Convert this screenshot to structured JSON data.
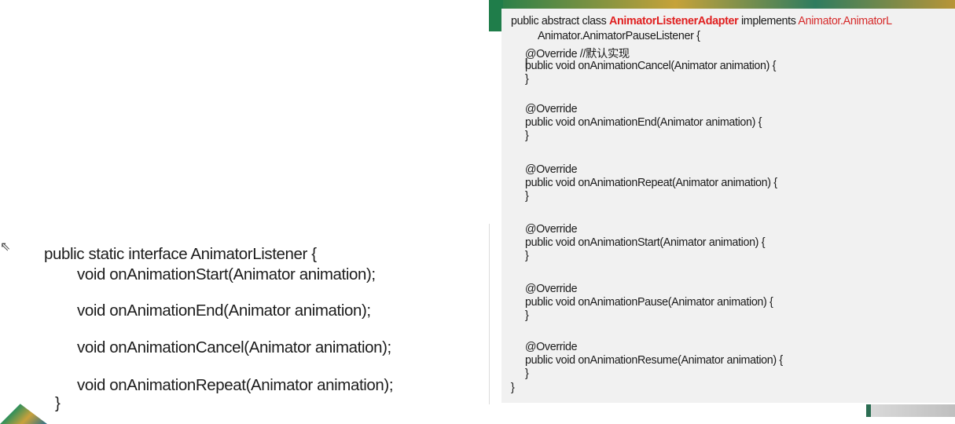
{
  "left_slide": {
    "lines": [
      "public static interface AnimatorListener {",
      "void onAnimationStart(Animator animation);",
      "void onAnimationEnd(Animator animation);",
      "void onAnimationCancel(Animator animation);",
      "void onAnimationRepeat(Animator animation);",
      "}"
    ]
  },
  "right_panel": {
    "header": {
      "prefix": "public abstract class ",
      "class_name": "AnimatorListenerAdapter",
      "implements": " implements ",
      "interface": "Animator.AnimatorL",
      "line2": "Animator.AnimatorPauseListener {"
    },
    "annotation_comment": "@Override //默认实现",
    "methods": [
      {
        "annotation": "",
        "signature": "public void onAnimationCancel(Animator animation) {",
        "close": "}"
      },
      {
        "annotation": "@Override",
        "signature": "public void onAnimationEnd(Animator animation) {",
        "close": "}"
      },
      {
        "annotation": "@Override",
        "signature": "public void onAnimationRepeat(Animator animation) {",
        "close": "}"
      },
      {
        "annotation": "@Override",
        "signature": "public void onAnimationStart(Animator animation) {",
        "close": "}"
      },
      {
        "annotation": "@Override",
        "signature": "public void onAnimationPause(Animator animation) {",
        "close": "}"
      },
      {
        "annotation": "@Override",
        "signature": "public void onAnimationResume(Animator animation) {",
        "close": "}"
      }
    ],
    "class_close": "}"
  },
  "colors": {
    "keyword_red": "#d62a2a",
    "class_red": "#e02020",
    "code_bg": "#f1f1f1",
    "accent_green": "#1f7d4a"
  },
  "icons": {
    "cursor": "text-cursor-icon",
    "arrow": "pointer-arrow-icon"
  }
}
